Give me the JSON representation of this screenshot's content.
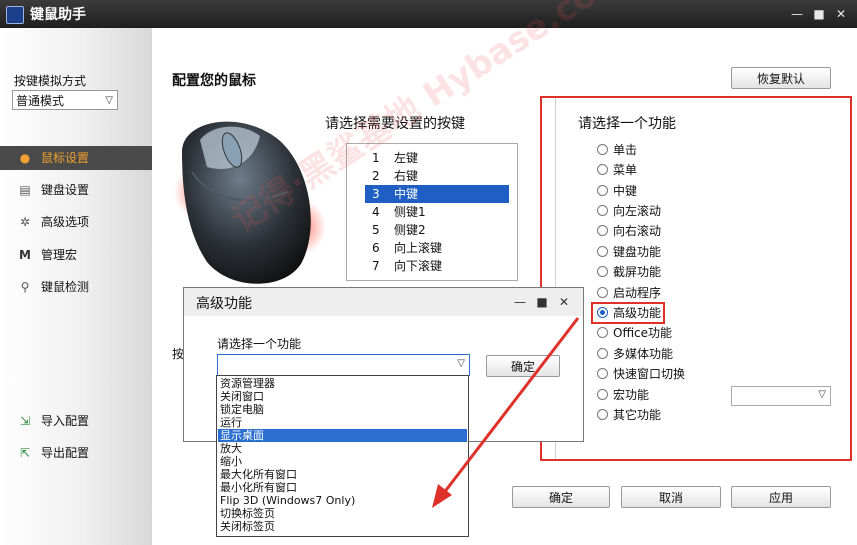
{
  "window": {
    "title": "键鼠助手",
    "min": "—",
    "max": "■",
    "close": "✕"
  },
  "sidebar": {
    "mode_label": "按键模拟方式",
    "mode_value": "普通模式",
    "items": [
      {
        "label": "鼠标设置",
        "icon": "mouse-icon",
        "active": true
      },
      {
        "label": "键盘设置",
        "icon": "keyboard-icon"
      },
      {
        "label": "高级选项",
        "icon": "gear-icon"
      },
      {
        "label": "管理宏",
        "icon": "macro-m-icon"
      },
      {
        "label": "键鼠检测",
        "icon": "magnifier-icon"
      }
    ],
    "import_label": "导入配置",
    "export_label": "导出配置"
  },
  "main": {
    "title": "配置您的鼠标",
    "reset_label": "恢复默认",
    "button_prompt": "请选择需要设置的按键",
    "buttons": [
      {
        "n": "1",
        "label": "左键"
      },
      {
        "n": "2",
        "label": "右键"
      },
      {
        "n": "3",
        "label": "中键",
        "selected": true
      },
      {
        "n": "4",
        "label": "侧键1"
      },
      {
        "n": "5",
        "label": "侧键2"
      },
      {
        "n": "6",
        "label": "向上滚键"
      },
      {
        "n": "7",
        "label": "向下滚键"
      }
    ],
    "partial_label": "按",
    "ok_label": "确定",
    "cancel_label": "取消",
    "apply_label": "应用"
  },
  "function_panel": {
    "title": "请选择一个功能",
    "options": [
      "单击",
      "菜单",
      "中键",
      "向左滚动",
      "向右滚动",
      "键盘功能",
      "截屏功能",
      "启动程序",
      "高级功能",
      "Office功能",
      "多媒体功能",
      "快速窗口切换",
      "宏功能",
      "其它功能"
    ],
    "selected": "高级功能"
  },
  "dialog": {
    "title": "高级功能",
    "label": "请选择一个功能",
    "ok_label": "确定",
    "options": [
      "资源管理器",
      "关闭窗口",
      "锁定电脑",
      "运行",
      "显示桌面",
      "放大",
      "缩小",
      "最大化所有窗口",
      "最小化所有窗口",
      "Flip 3D (Windows7 Only)",
      "切换标签页",
      "关闭标签页"
    ],
    "highlighted": "显示桌面"
  },
  "watermark": "记得·黑鲨基地 Hybase.com",
  "colors": {
    "highlight_red": "#e0302a",
    "selection_blue": "#1f5fc4",
    "active_nav": "#f0a030"
  }
}
